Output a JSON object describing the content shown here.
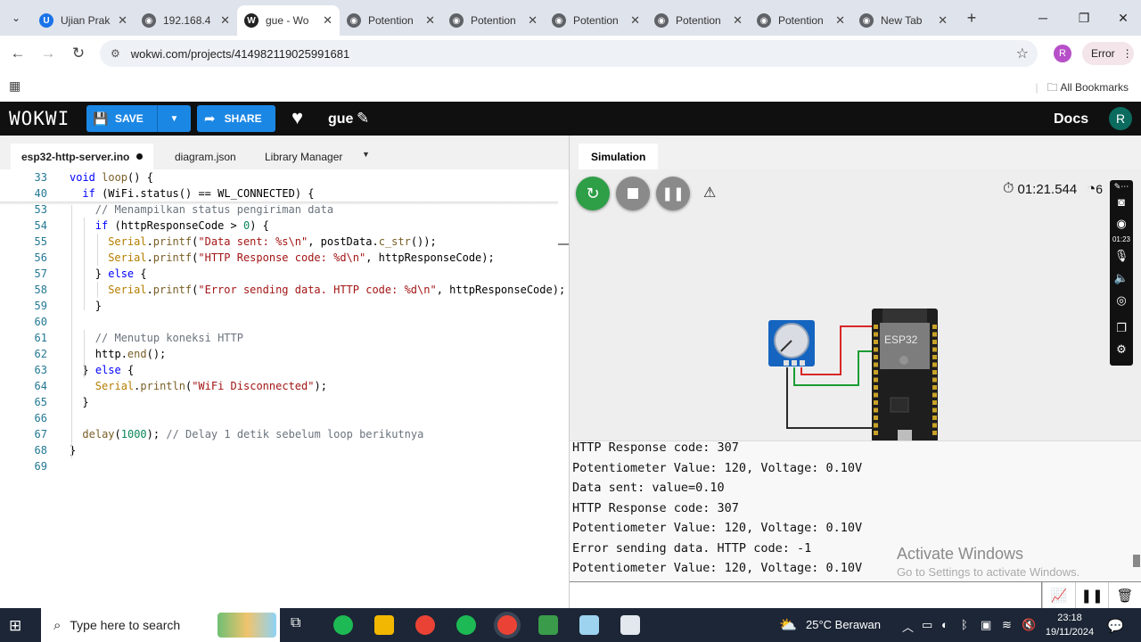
{
  "browser": {
    "tabs": [
      {
        "label": "Ujian Prak",
        "fav": "U",
        "color": "#1a73e8"
      },
      {
        "label": "192.168.4",
        "fav": "◉",
        "color": "#5f6368"
      },
      {
        "label": "gue - Wo",
        "fav": "W",
        "color": "#222222",
        "active": true
      },
      {
        "label": "Potention",
        "fav": "◉",
        "color": "#5f6368"
      },
      {
        "label": "Potention",
        "fav": "◉",
        "color": "#5f6368"
      },
      {
        "label": "Potention",
        "fav": "◉",
        "color": "#5f6368"
      },
      {
        "label": "Potention",
        "fav": "◉",
        "color": "#5f6368"
      },
      {
        "label": "Potention",
        "fav": "◉",
        "color": "#5f6368"
      },
      {
        "label": "New Tab",
        "fav": "◉",
        "color": "#5f6368"
      }
    ],
    "url": "wokwi.com/projects/414982119025991681",
    "profile_initial": "R",
    "error_label": "Error",
    "bookmarks_label": "All Bookmarks"
  },
  "wokwi": {
    "logo": "WOKWI",
    "save_label": "SAVE",
    "share_label": "SHARE",
    "project_name": "gue",
    "docs_label": "Docs",
    "avatar_initial": "R"
  },
  "editor": {
    "tabs": [
      "esp32-http-server.ino",
      "diagram.json",
      "Library Manager"
    ],
    "lines": [
      {
        "n": "33",
        "indent": 0,
        "parts": [
          [
            "kw",
            "void "
          ],
          [
            "fn",
            "loop"
          ],
          [
            "plain",
            "() {"
          ]
        ]
      },
      {
        "n": "40",
        "indent": 1,
        "parts": [
          [
            "kw",
            "if "
          ],
          [
            "plain",
            "(WiFi.status() == WL_CONNECTED) {"
          ]
        ]
      },
      {
        "n": "53",
        "indent": 2,
        "parts": [
          [
            "cm",
            "// Menampilkan status pengiriman data"
          ]
        ]
      },
      {
        "n": "54",
        "indent": 2,
        "parts": [
          [
            "kw",
            "if "
          ],
          [
            "plain",
            "(httpResponseCode > "
          ],
          [
            "num",
            "0"
          ],
          [
            "plain",
            ") {"
          ]
        ]
      },
      {
        "n": "55",
        "indent": 3,
        "parts": [
          [
            "ser",
            "Serial"
          ],
          [
            "plain",
            "."
          ],
          [
            "fn",
            "printf"
          ],
          [
            "plain",
            "("
          ],
          [
            "str",
            "\"Data sent: %s\\n\""
          ],
          [
            "plain",
            ", postData."
          ],
          [
            "fn",
            "c_str"
          ],
          [
            "plain",
            "());"
          ]
        ]
      },
      {
        "n": "56",
        "indent": 3,
        "parts": [
          [
            "ser",
            "Serial"
          ],
          [
            "plain",
            "."
          ],
          [
            "fn",
            "printf"
          ],
          [
            "plain",
            "("
          ],
          [
            "str",
            "\"HTTP Response code: %d\\n\""
          ],
          [
            "plain",
            ", httpResponseCode);"
          ]
        ]
      },
      {
        "n": "57",
        "indent": 2,
        "parts": [
          [
            "plain",
            "} "
          ],
          [
            "kw",
            "else "
          ],
          [
            "plain",
            "{"
          ]
        ]
      },
      {
        "n": "58",
        "indent": 3,
        "parts": [
          [
            "ser",
            "Serial"
          ],
          [
            "plain",
            "."
          ],
          [
            "fn",
            "printf"
          ],
          [
            "plain",
            "("
          ],
          [
            "str",
            "\"Error sending data. HTTP code: %d\\n\""
          ],
          [
            "plain",
            ", httpResponseCode);"
          ]
        ]
      },
      {
        "n": "59",
        "indent": 2,
        "parts": [
          [
            "plain",
            "}"
          ]
        ]
      },
      {
        "n": "60",
        "indent": 0,
        "parts": []
      },
      {
        "n": "61",
        "indent": 2,
        "parts": [
          [
            "cm",
            "// Menutup koneksi HTTP"
          ]
        ]
      },
      {
        "n": "62",
        "indent": 2,
        "parts": [
          [
            "plain",
            "http."
          ],
          [
            "fn",
            "end"
          ],
          [
            "plain",
            "();"
          ]
        ]
      },
      {
        "n": "63",
        "indent": 1,
        "parts": [
          [
            "plain",
            "} "
          ],
          [
            "kw",
            "else "
          ],
          [
            "plain",
            "{"
          ]
        ]
      },
      {
        "n": "64",
        "indent": 2,
        "parts": [
          [
            "ser",
            "Serial"
          ],
          [
            "plain",
            "."
          ],
          [
            "fn",
            "println"
          ],
          [
            "plain",
            "("
          ],
          [
            "str",
            "\"WiFi Disconnected\""
          ],
          [
            "plain",
            ");"
          ]
        ]
      },
      {
        "n": "65",
        "indent": 1,
        "parts": [
          [
            "plain",
            "}"
          ]
        ]
      },
      {
        "n": "66",
        "indent": 0,
        "parts": []
      },
      {
        "n": "67",
        "indent": 1,
        "parts": [
          [
            "fn",
            "delay"
          ],
          [
            "plain",
            "("
          ],
          [
            "num",
            "1000"
          ],
          [
            "plain",
            "); "
          ],
          [
            "cm",
            "// Delay 1 detik sebelum loop berikutnya"
          ]
        ]
      },
      {
        "n": "68",
        "indent": 0,
        "parts": [
          [
            "plain",
            "}"
          ]
        ]
      },
      {
        "n": "69",
        "indent": 0,
        "parts": []
      }
    ]
  },
  "simulation": {
    "tab_label": "Simulation",
    "timer": "01:21.544",
    "speed_partial": "6",
    "tool_time_label": "01:23",
    "esp_label": "ESP32",
    "serial_lines": [
      "HTTP Response code: 307",
      "Potentiometer Value: 120, Voltage: 0.10V",
      "Data sent: value=0.10",
      "HTTP Response code: 307",
      "Potentiometer Value: 120, Voltage: 0.10V",
      "Error sending data. HTTP code: -1",
      "Potentiometer Value: 120, Voltage: 0.10V"
    ],
    "watermark_title": "Activate Windows",
    "watermark_sub": "Go to Settings to activate Windows."
  },
  "taskbar": {
    "search_placeholder": "Type here to search",
    "weather": "25°C  Berawan",
    "time": "23:18",
    "date": "19/11/2024"
  },
  "colors": {
    "accent": "#1b87e5",
    "restart": "#2e9e47",
    "control_grey": "#8a8a8a",
    "board": "#1e1e1e",
    "pot_blue": "#1565c0"
  }
}
